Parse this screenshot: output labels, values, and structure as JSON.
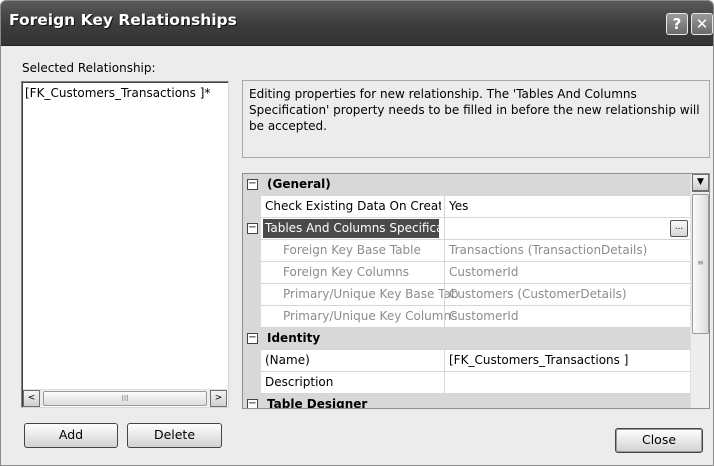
{
  "window": {
    "title": "Foreign Key Relationships",
    "help_label": "?",
    "close_label": "✕"
  },
  "left": {
    "label": "Selected Relationship:",
    "items": [
      "[FK_Customers_Transactions ]*"
    ],
    "scroll_left": "<",
    "scroll_right": ">",
    "scroll_thumb_grip": "III"
  },
  "description": "Editing properties for new relationship.  The 'Tables And Columns Specification' property needs to be filled in before the new relationship will be accepted.",
  "grid": {
    "rows": [
      {
        "kind": "cat",
        "expander": "⊟",
        "name": "(General)",
        "value": ""
      },
      {
        "kind": "prop",
        "name": "Check Existing Data On Creation",
        "value": "Yes"
      },
      {
        "kind": "sel",
        "expander": "⊟",
        "name": "Tables And Columns Specification",
        "value": "",
        "button": "..."
      },
      {
        "kind": "child",
        "name": "Foreign Key Base Table",
        "value": "Transactions (TransactionDetails)"
      },
      {
        "kind": "child",
        "name": "Foreign Key Columns",
        "value": "CustomerId"
      },
      {
        "kind": "child",
        "name": "Primary/Unique Key Base Table",
        "value": "Customers (CustomerDetails)"
      },
      {
        "kind": "child",
        "name": "Primary/Unique Key Columns",
        "value": "CustomerId"
      },
      {
        "kind": "cat",
        "expander": "⊟",
        "name": "Identity",
        "value": ""
      },
      {
        "kind": "prop",
        "name": "(Name)",
        "value": "[FK_Customers_Transactions ]"
      },
      {
        "kind": "prop",
        "name": "Description",
        "value": ""
      },
      {
        "kind": "cat",
        "expander": "⊟",
        "name": "Table Designer",
        "value": ""
      }
    ],
    "scroll_up": "▲",
    "scroll_down": "▼",
    "scroll_thumb_grip": "≡"
  },
  "buttons": {
    "add": "Add",
    "delete": "Delete",
    "close": "Close"
  },
  "colors": {
    "titlebar": "#3c3c3c",
    "selected_row": "#4a4a4a",
    "category_row": "#d8d8d8",
    "disabled_text": "#8c8c8c"
  }
}
